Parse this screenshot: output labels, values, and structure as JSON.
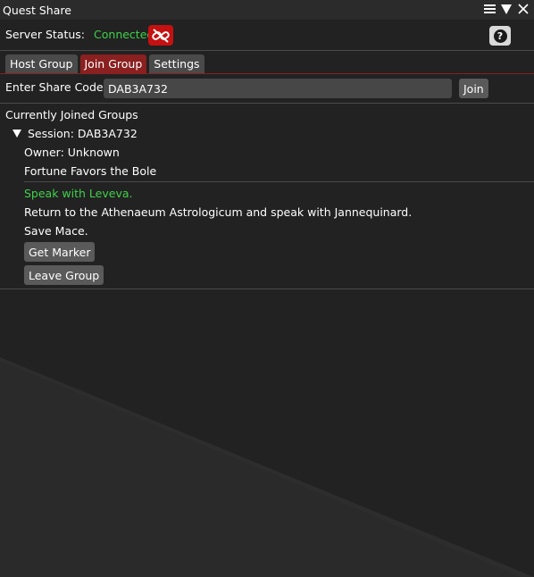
{
  "window": {
    "title": "Quest Share"
  },
  "titlebar_icons": [
    "hamburger-menu-icon",
    "collapse-triangle-icon",
    "close-icon"
  ],
  "server_status": {
    "label": "Server Status:",
    "value": "Connected",
    "value_color": "#3fd14a",
    "disconnect_icon": "unlink-chain-icon",
    "help_icon": "question-mark-icon"
  },
  "tabs": [
    {
      "label": "Host Group",
      "active": false
    },
    {
      "label": "Join Group",
      "active": true
    },
    {
      "label": "Settings",
      "active": false
    }
  ],
  "share_code": {
    "label": "Enter Share Code:",
    "value": "DAB3A732",
    "join_label": "Join"
  },
  "groups": {
    "heading": "Currently Joined Groups",
    "session_label": "Session: DAB3A732",
    "owner": "Owner: Unknown",
    "quest_name": "Fortune Favors the Bole",
    "objective_current": "Speak with Leveva.",
    "objectives": [
      "Return to the Athenaeum Astrologicum and speak with Jannequinard.",
      "Save Mace."
    ],
    "get_marker_label": "Get Marker",
    "leave_group_label": "Leave Group"
  },
  "colors": {
    "accent": "#8a2020",
    "status_green": "#3fd14a",
    "disconnect_red": "#c51111"
  }
}
